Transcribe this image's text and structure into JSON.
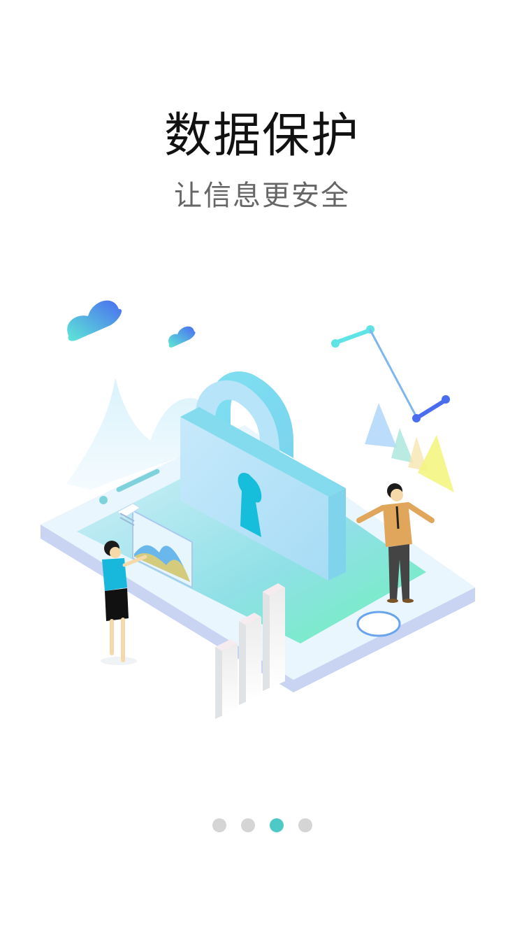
{
  "onboarding": {
    "title": "数据保护",
    "subtitle": "让信息更安全",
    "illustration_icon": "padlock-security-illustration",
    "pagination": {
      "total": 4,
      "active_index": 2,
      "active_color": "#4ec9c6",
      "inactive_color": "#d5d5d5"
    }
  }
}
